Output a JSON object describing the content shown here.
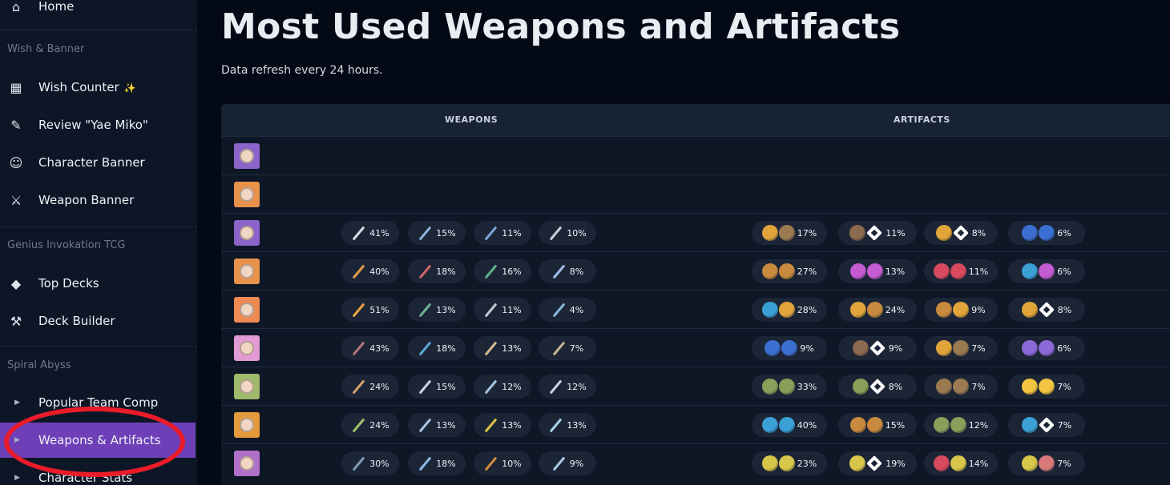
{
  "sidebar": {
    "home_label": "Home",
    "section_wish": "Wish & Banner",
    "wish_counter_label": "Wish Counter",
    "wish_counter_badge": "✨",
    "review_label": "Review \"Yae Miko\"",
    "character_banner_label": "Character Banner",
    "weapon_banner_label": "Weapon Banner",
    "section_tcg": "Genius Invokation TCG",
    "top_decks_label": "Top Decks",
    "deck_builder_label": "Deck Builder",
    "section_abyss": "Spiral Abyss",
    "popular_team_label": "Popular Team Comp",
    "weapons_artifacts_label": "Weapons & Artifacts",
    "character_stats_label": "Character Stats",
    "active_color": "#6f3fb8"
  },
  "main": {
    "title": "Most Used Weapons and Artifacts",
    "subtitle": "Data refresh every 24 hours.",
    "weapons_header": "WEAPONS",
    "artifacts_header": "ARTIFACTS"
  },
  "rows": [
    {
      "avatar_color": "#8b64c9",
      "weapons": [],
      "artifacts": []
    },
    {
      "avatar_color": "#e8914a",
      "weapons": [],
      "artifacts": []
    },
    {
      "avatar_color": "#8b64c9",
      "weapons": [
        {
          "pct": "41%",
          "icon": "#d7dde6"
        },
        {
          "pct": "15%",
          "icon": "#8fb0d6"
        },
        {
          "pct": "11%",
          "icon": "#7ea7d9"
        },
        {
          "pct": "10%",
          "icon": "#c9ced6"
        }
      ],
      "artifacts": [
        {
          "a": "#e0a43a",
          "b": "#9b7a52",
          "pct": "17%"
        },
        {
          "a": "#8c6a4f",
          "b": "diamond",
          "pct": "11%"
        },
        {
          "a": "#e0a43a",
          "b": "diamond",
          "pct": "8%"
        },
        {
          "a": "#3b6fd1",
          "b": "#3b6fd1",
          "pct": "6%"
        }
      ]
    },
    {
      "avatar_color": "#e8914a",
      "weapons": [
        {
          "pct": "40%",
          "icon": "#e39a4a"
        },
        {
          "pct": "18%",
          "icon": "#d0646a"
        },
        {
          "pct": "16%",
          "icon": "#5fb08e"
        },
        {
          "pct": "8%",
          "icon": "#9fbde8"
        }
      ],
      "artifacts": [
        {
          "a": "#c88a3e",
          "b": "#c88a3e",
          "pct": "27%"
        },
        {
          "a": "#c45bd1",
          "b": "#c45bd1",
          "pct": "13%"
        },
        {
          "a": "#d84a5e",
          "b": "#d84a5e",
          "pct": "11%"
        },
        {
          "a": "#3ba0d6",
          "b": "#c45bd1",
          "pct": "6%"
        }
      ]
    },
    {
      "avatar_color": "#ee8a52",
      "weapons": [
        {
          "pct": "51%",
          "icon": "#e8a43e"
        },
        {
          "pct": "13%",
          "icon": "#6cb38f"
        },
        {
          "pct": "11%",
          "icon": "#c3cbd6"
        },
        {
          "pct": "4%",
          "icon": "#86b9d6"
        }
      ],
      "artifacts": [
        {
          "a": "#3ba0d6",
          "b": "#e0a43a",
          "pct": "28%"
        },
        {
          "a": "#e0a43a",
          "b": "#c88a3e",
          "pct": "24%"
        },
        {
          "a": "#c88a3e",
          "b": "#e0a43a",
          "pct": "9%"
        },
        {
          "a": "#e0a43a",
          "b": "diamond",
          "pct": "8%"
        }
      ]
    },
    {
      "avatar_color": "#e29ad4",
      "weapons": [
        {
          "pct": "43%",
          "icon": "#b27878"
        },
        {
          "pct": "18%",
          "icon": "#5da9d6"
        },
        {
          "pct": "13%",
          "icon": "#d7b98e"
        },
        {
          "pct": "7%",
          "icon": "#c9b59a"
        }
      ],
      "artifacts": [
        {
          "a": "#3b6fd1",
          "b": "#3b6fd1",
          "pct": "9%"
        },
        {
          "a": "#8c6a4f",
          "b": "diamond",
          "pct": "9%"
        },
        {
          "a": "#e0a43a",
          "b": "#9b7a52",
          "pct": "7%"
        },
        {
          "a": "#8b6ad8",
          "b": "#8b6ad8",
          "pct": "6%"
        }
      ]
    },
    {
      "avatar_color": "#9fba6a",
      "weapons": [
        {
          "pct": "24%",
          "icon": "#d9a36a"
        },
        {
          "pct": "15%",
          "icon": "#c9d3e0"
        },
        {
          "pct": "12%",
          "icon": "#a6c3e0"
        },
        {
          "pct": "12%",
          "icon": "#c9d3e0"
        }
      ],
      "artifacts": [
        {
          "a": "#8aa05a",
          "b": "#8aa05a",
          "pct": "33%"
        },
        {
          "a": "#8aa05a",
          "b": "diamond",
          "pct": "8%"
        },
        {
          "a": "#9b7a52",
          "b": "#9b7a52",
          "pct": "7%"
        },
        {
          "a": "#f2c440",
          "b": "#f2c440",
          "pct": "7%"
        }
      ]
    },
    {
      "avatar_color": "#e39a3a",
      "weapons": [
        {
          "pct": "24%",
          "icon": "#a3c06a"
        },
        {
          "pct": "13%",
          "icon": "#a9c3e0"
        },
        {
          "pct": "13%",
          "icon": "#e0c244"
        },
        {
          "pct": "13%",
          "icon": "#a9d0e8"
        }
      ],
      "artifacts": [
        {
          "a": "#3ba0d6",
          "b": "#3ba0d6",
          "pct": "40%"
        },
        {
          "a": "#c88a3e",
          "b": "#c88a3e",
          "pct": "15%"
        },
        {
          "a": "#8aa05a",
          "b": "#8aa05a",
          "pct": "12%"
        },
        {
          "a": "#3ba0d6",
          "b": "diamond",
          "pct": "7%"
        }
      ]
    },
    {
      "avatar_color": "#b070c8",
      "weapons": [
        {
          "pct": "30%",
          "icon": "#7e9bb8"
        },
        {
          "pct": "18%",
          "icon": "#8fb8e6"
        },
        {
          "pct": "10%",
          "icon": "#d48a3a"
        },
        {
          "pct": "9%",
          "icon": "#a8c8e6"
        }
      ],
      "artifacts": [
        {
          "a": "#d8c64a",
          "b": "#d8c64a",
          "pct": "23%"
        },
        {
          "a": "#d8c64a",
          "b": "diamond",
          "pct": "19%"
        },
        {
          "a": "#d84a5e",
          "b": "#d8c64a",
          "pct": "14%"
        },
        {
          "a": "#d8c64a",
          "b": "#d87a7a",
          "pct": "7%"
        }
      ]
    }
  ]
}
